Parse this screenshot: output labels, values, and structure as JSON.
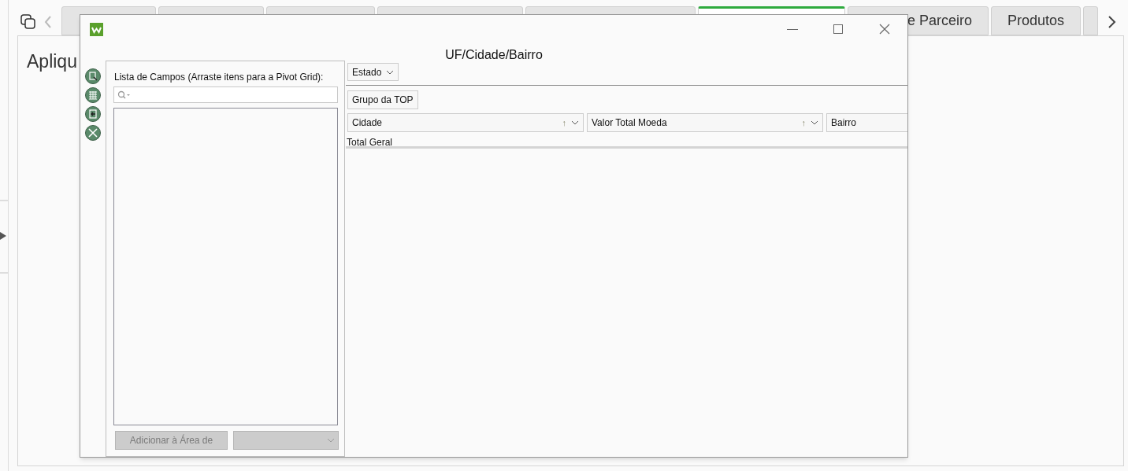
{
  "background": {
    "tabs": [
      {
        "selected": false
      },
      {
        "selected": false
      },
      {
        "selected": false
      },
      {
        "selected": false
      },
      {
        "selected": false
      },
      {
        "selected": true
      },
      {
        "label": "e Parceiro",
        "selected": false
      },
      {
        "label": "Produtos",
        "selected": false
      },
      {
        "selected": false
      }
    ],
    "heading": "Apliqu"
  },
  "dialog": {
    "title": "UF/Cidade/Bairro",
    "field_list": {
      "label": "Lista de Campos (Arraste itens para a Pivot Grid):",
      "add_button": "Adicionar à Área de",
      "add_disabled": true
    },
    "filter_fields": [
      "Estado"
    ],
    "column_fields": [
      "Grupo da TOP"
    ],
    "row_fields": [
      {
        "label": "Cidade",
        "sort_arrow": "↑"
      },
      {
        "label": "Valor Total Moeda",
        "sort_arrow": "↑"
      },
      {
        "label": "Bairro"
      }
    ],
    "grand_total": "Total Geral"
  }
}
